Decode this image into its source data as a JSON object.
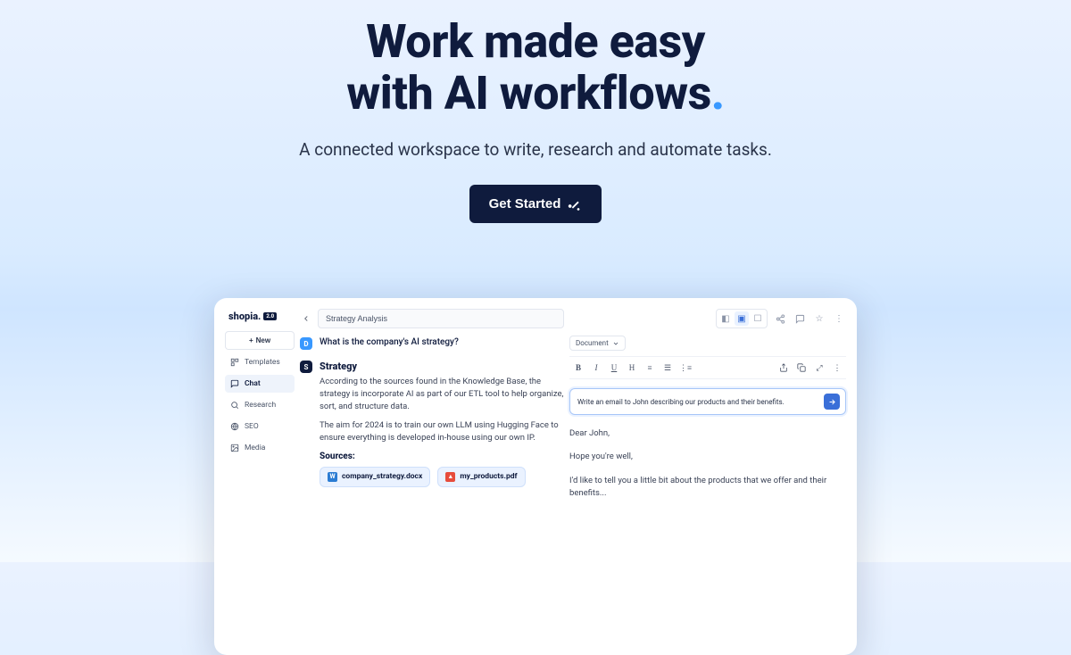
{
  "hero": {
    "title_line1": "Work made easy",
    "title_line2": "with AI workflows",
    "title_dot": ".",
    "subtitle": "A connected workspace to write, research and automate tasks.",
    "cta_label": "Get Started"
  },
  "app": {
    "brand": "shopia.",
    "brand_badge": "2.0",
    "sidebar": {
      "new_label": "New",
      "items": [
        {
          "id": "templates",
          "label": "Templates",
          "icon": "templates-icon"
        },
        {
          "id": "chat",
          "label": "Chat",
          "icon": "chat-icon",
          "active": true
        },
        {
          "id": "research",
          "label": "Research",
          "icon": "search-icon"
        },
        {
          "id": "seo",
          "label": "SEO",
          "icon": "globe-icon"
        },
        {
          "id": "media",
          "label": "Media",
          "icon": "image-icon"
        }
      ]
    },
    "chat": {
      "thread_title": "Strategy Analysis",
      "user_initial": "D",
      "user_question": "What is the company's AI strategy?",
      "ai_initial": "S",
      "answer_heading": "Strategy",
      "answer_p1": "According to the sources found in the Knowledge Base, the strategy is incorporate AI as part of our ETL tool to help organize, sort, and structure data.",
      "answer_p2": "The aim for 2024 is to train our own LLM using Hugging Face to ensure everything is developed in-house using our own IP.",
      "sources_heading": "Sources:",
      "sources": [
        {
          "name": "company_strategy.docx",
          "type": "docx"
        },
        {
          "name": "my_products.pdf",
          "type": "pdf"
        }
      ]
    },
    "doc": {
      "type_label": "Document",
      "prompt_text": "Write an email to John describing our products and their benefits.",
      "body_p1": "Dear John,",
      "body_p2": "Hope you're well,",
      "body_p3": "I'd like to tell you a little bit about the products that we offer and their benefits..."
    }
  }
}
